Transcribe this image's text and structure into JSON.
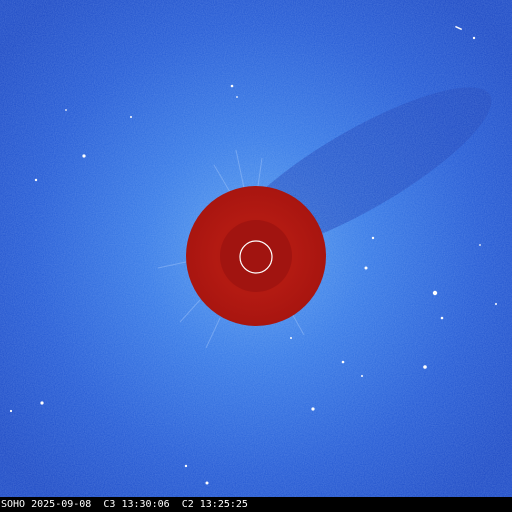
{
  "image": {
    "kind": "SOHO LASCO C2/C3 combined coronagraph view",
    "background_color": "#1a4fd0",
    "occulter_color": "#b01810",
    "sun_outline_color": "#ffffff"
  },
  "caption": {
    "observatory": "SOHO",
    "date": "2025-09-08",
    "c3_label": "C3",
    "c3_time": "13:30:06",
    "c2_label": "C2",
    "c2_time": "13:25:25"
  }
}
